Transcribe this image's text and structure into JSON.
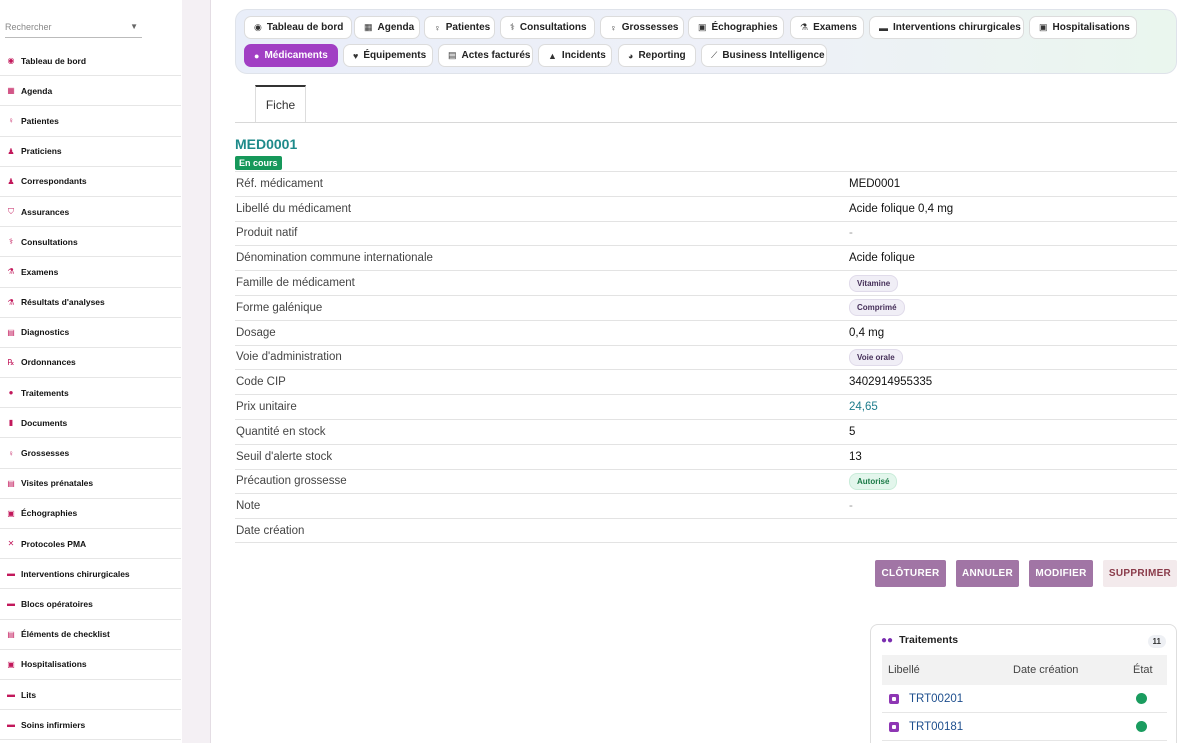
{
  "sidebar": {
    "search_placeholder": "Rechercher",
    "items": [
      {
        "label": "Tableau de bord",
        "icon": "dashboard-icon",
        "glyph": "◉"
      },
      {
        "label": "Agenda",
        "icon": "calendar-icon",
        "glyph": "▦"
      },
      {
        "label": "Patientes",
        "icon": "female-icon",
        "glyph": "♀"
      },
      {
        "label": "Praticiens",
        "icon": "user-doctor-icon",
        "glyph": "♟"
      },
      {
        "label": "Correspondants",
        "icon": "user-icon",
        "glyph": "♟"
      },
      {
        "label": "Assurances",
        "icon": "shield-icon",
        "glyph": "⛉"
      },
      {
        "label": "Consultations",
        "icon": "stethoscope-icon",
        "glyph": "⚕"
      },
      {
        "label": "Examens",
        "icon": "microscope-icon",
        "glyph": "⚗"
      },
      {
        "label": "Résultats d'analyses",
        "icon": "flask-icon",
        "glyph": "⚗"
      },
      {
        "label": "Diagnostics",
        "icon": "clipboard-icon",
        "glyph": "▤"
      },
      {
        "label": "Ordonnances",
        "icon": "prescription-icon",
        "glyph": "℞"
      },
      {
        "label": "Traitements",
        "icon": "pills-icon",
        "glyph": "●"
      },
      {
        "label": "Documents",
        "icon": "file-icon",
        "glyph": "▮"
      },
      {
        "label": "Grossesses",
        "icon": "person-pregnant-icon",
        "glyph": "♀"
      },
      {
        "label": "Visites prénatales",
        "icon": "file-medical-icon",
        "glyph": "▤"
      },
      {
        "label": "Échographies",
        "icon": "ultrasound-icon",
        "glyph": "▣"
      },
      {
        "label": "Protocoles PMA",
        "icon": "dna-icon",
        "glyph": "✕"
      },
      {
        "label": "Interventions chirurgicales",
        "icon": "procedures-icon",
        "glyph": "▬"
      },
      {
        "label": "Blocs opératoires",
        "icon": "operating-room-icon",
        "glyph": "▬"
      },
      {
        "label": "Éléments de checklist",
        "icon": "checklist-icon",
        "glyph": "▤"
      },
      {
        "label": "Hospitalisations",
        "icon": "hospital-user-icon",
        "glyph": "▣"
      },
      {
        "label": "Lits",
        "icon": "bed-icon",
        "glyph": "▬"
      },
      {
        "label": "Soins infirmiers",
        "icon": "nurse-icon",
        "glyph": "▬"
      }
    ]
  },
  "topnav": {
    "tabs": [
      {
        "label": "Tableau de bord",
        "icon": "dashboard-icon",
        "glyph": "◉"
      },
      {
        "label": "Agenda",
        "icon": "calendar-icon",
        "glyph": "▦"
      },
      {
        "label": "Patientes",
        "icon": "female-icon",
        "glyph": "♀"
      },
      {
        "label": "Consultations",
        "icon": "stethoscope-icon",
        "glyph": "⚕"
      },
      {
        "label": "Grossesses",
        "icon": "person-pregnant-icon",
        "glyph": "♀"
      },
      {
        "label": "Échographies",
        "icon": "ultrasound-icon",
        "glyph": "▣"
      },
      {
        "label": "Examens",
        "icon": "microscope-icon",
        "glyph": "⚗"
      },
      {
        "label": "Interventions chirurgicales",
        "icon": "procedures-icon",
        "glyph": "▬"
      },
      {
        "label": "Hospitalisations",
        "icon": "hospital-user-icon",
        "glyph": "▣"
      },
      {
        "label": "Médicaments",
        "icon": "pills-icon",
        "glyph": "●",
        "active": true
      },
      {
        "label": "Équipements",
        "icon": "heart-icon",
        "glyph": "♥"
      },
      {
        "label": "Actes facturés",
        "icon": "invoice-icon",
        "glyph": "▤"
      },
      {
        "label": "Incidents",
        "icon": "warning-icon",
        "glyph": "▲"
      },
      {
        "label": "Reporting",
        "icon": "pie-chart-icon",
        "glyph": "◕"
      },
      {
        "label": "Business Intelligence",
        "icon": "line-chart-icon",
        "glyph": "⟋"
      }
    ]
  },
  "subtabs": {
    "fiche": "Fiche"
  },
  "record": {
    "id": "MED0001",
    "status": "En cours",
    "fields": [
      {
        "label": "Réf. médicament",
        "value": "MED0001",
        "kind": "text"
      },
      {
        "label": "Libellé du médicament",
        "value": "Acide folique 0,4 mg",
        "kind": "text"
      },
      {
        "label": "Produit natif",
        "value": "-",
        "kind": "dash"
      },
      {
        "label": "Dénomination commune internationale",
        "value": "Acide folique",
        "kind": "text"
      },
      {
        "label": "Famille de médicament",
        "value": "Vitamine",
        "kind": "pill"
      },
      {
        "label": "Forme galénique",
        "value": "Comprimé",
        "kind": "pill"
      },
      {
        "label": "Dosage",
        "value": "0,4 mg",
        "kind": "text"
      },
      {
        "label": "Voie d'administration",
        "value": "Voie orale",
        "kind": "pill"
      },
      {
        "label": "Code CIP",
        "value": "3402914955335",
        "kind": "text"
      },
      {
        "label": "Prix unitaire",
        "value": "24,65",
        "kind": "link"
      },
      {
        "label": "Quantité en stock",
        "value": "5",
        "kind": "text"
      },
      {
        "label": "Seuil d'alerte stock",
        "value": "13",
        "kind": "text"
      },
      {
        "label": "Précaution grossesse",
        "value": "Autorisé",
        "kind": "pill-green"
      },
      {
        "label": "Note",
        "value": "-",
        "kind": "dash"
      },
      {
        "label": "Date création",
        "value": "",
        "kind": "text"
      }
    ]
  },
  "actions": {
    "close": "CLÔTURER",
    "cancel": "ANNULER",
    "edit": "MODIFIER",
    "delete": "SUPPRIMER"
  },
  "treatments": {
    "title": "Traitements",
    "count": "11",
    "columns": {
      "label": "Libellé",
      "date": "Date création",
      "state": "État"
    },
    "rows": [
      {
        "label": "TRT00201",
        "date": "",
        "state_color": "#1a9c5f"
      },
      {
        "label": "TRT00181",
        "date": "",
        "state_color": "#1a9c5f"
      }
    ]
  },
  "colors": {
    "accent": "#a13fc4",
    "record_id": "#1e8a8a",
    "status_badge": "#16985a",
    "action_primary": "#a175a5",
    "sidebar_icon": "#c2185b"
  }
}
